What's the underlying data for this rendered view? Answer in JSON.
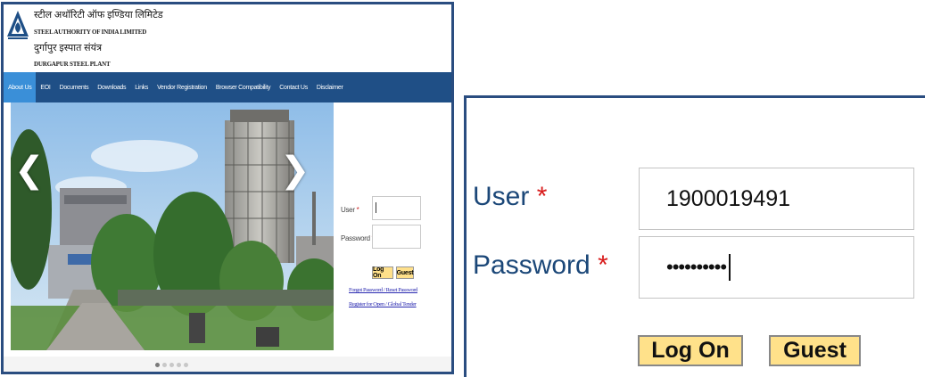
{
  "brand": {
    "hindi_name": "स्टील अथॉरिटी ऑफ इण्डिया लिमिटेड",
    "english_name": "STEEL AUTHORITY OF INDIA LIMITED",
    "hindi_plant": "दुर्गापुर इस्पात संयंत्र",
    "english_plant": "DURGAPUR STEEL PLANT",
    "logo_icon": "sail-logo-icon",
    "brand_color": "#1f4f86"
  },
  "nav": {
    "items": [
      {
        "label": "About Us",
        "active": true
      },
      {
        "label": "EOI"
      },
      {
        "label": "Documents"
      },
      {
        "label": "Downloads"
      },
      {
        "label": "Links"
      },
      {
        "label": "Vendor Registration"
      },
      {
        "label": "Browser Compatibility"
      },
      {
        "label": "Contact Us"
      },
      {
        "label": "Disclaimer"
      }
    ]
  },
  "slider": {
    "prev_icon": "chevron-left-icon",
    "next_icon": "chevron-right-icon",
    "prev_glyph": "❮",
    "next_glyph": "❯",
    "slide_count": 5,
    "active_slide": 1
  },
  "small_login": {
    "user_label": "User",
    "password_label": "Password",
    "required_mark": "*",
    "logon_label": "Log On",
    "guest_label": "Guest",
    "forgot_link": "Forgot Password / Reset Password",
    "register_link": "Register for Open / Global Tender"
  },
  "zoom_login": {
    "user_label": "User",
    "password_label": "Password",
    "required_mark": "*",
    "user_value": "1900019491",
    "password_mask": "••••••••••",
    "logon_label": "Log On",
    "guest_label": "Guest"
  }
}
